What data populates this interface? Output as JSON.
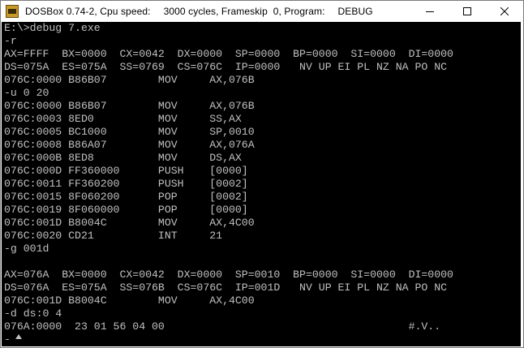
{
  "window": {
    "title": {
      "app": "DOSBox 0.74-2, Cpu speed:",
      "cycles": "3000 cycles, Frameskip  0, Program:",
      "program": "DEBUG"
    },
    "controls": [
      "minimize",
      "maximize",
      "close"
    ]
  },
  "console": {
    "lines": [
      "E:\\>debug 7.exe",
      "-r",
      "AX=FFFF  BX=0000  CX=0042  DX=0000  SP=0000  BP=0000  SI=0000  DI=0000",
      "DS=075A  ES=075A  SS=0769  CS=076C  IP=0000   NV UP EI PL NZ NA PO NC",
      "076C:0000 B86B07        MOV     AX,076B",
      "-u 0 20",
      "076C:0000 B86B07        MOV     AX,076B",
      "076C:0003 8ED0          MOV     SS,AX",
      "076C:0005 BC1000        MOV     SP,0010",
      "076C:0008 B86A07        MOV     AX,076A",
      "076C:000B 8ED8          MOV     DS,AX",
      "076C:000D FF360000      PUSH    [0000]",
      "076C:0011 FF360200      PUSH    [0002]",
      "076C:0015 8F060200      POP     [0002]",
      "076C:0019 8F060000      POP     [0000]",
      "076C:001D B8004C        MOV     AX,4C00",
      "076C:0020 CD21          INT     21",
      "-g 001d",
      "",
      "AX=076A  BX=0000  CX=0042  DX=0000  SP=0010  BP=0000  SI=0000  DI=0000",
      "DS=076A  ES=075A  SS=076B  CS=076C  IP=001D   NV UP EI PL NZ NA PO NC",
      "076C:001D B8004C        MOV     AX,4C00",
      "-d ds:0 4",
      "076A:0000  23 01 56 04 00                                      #.V..",
      "-"
    ]
  }
}
